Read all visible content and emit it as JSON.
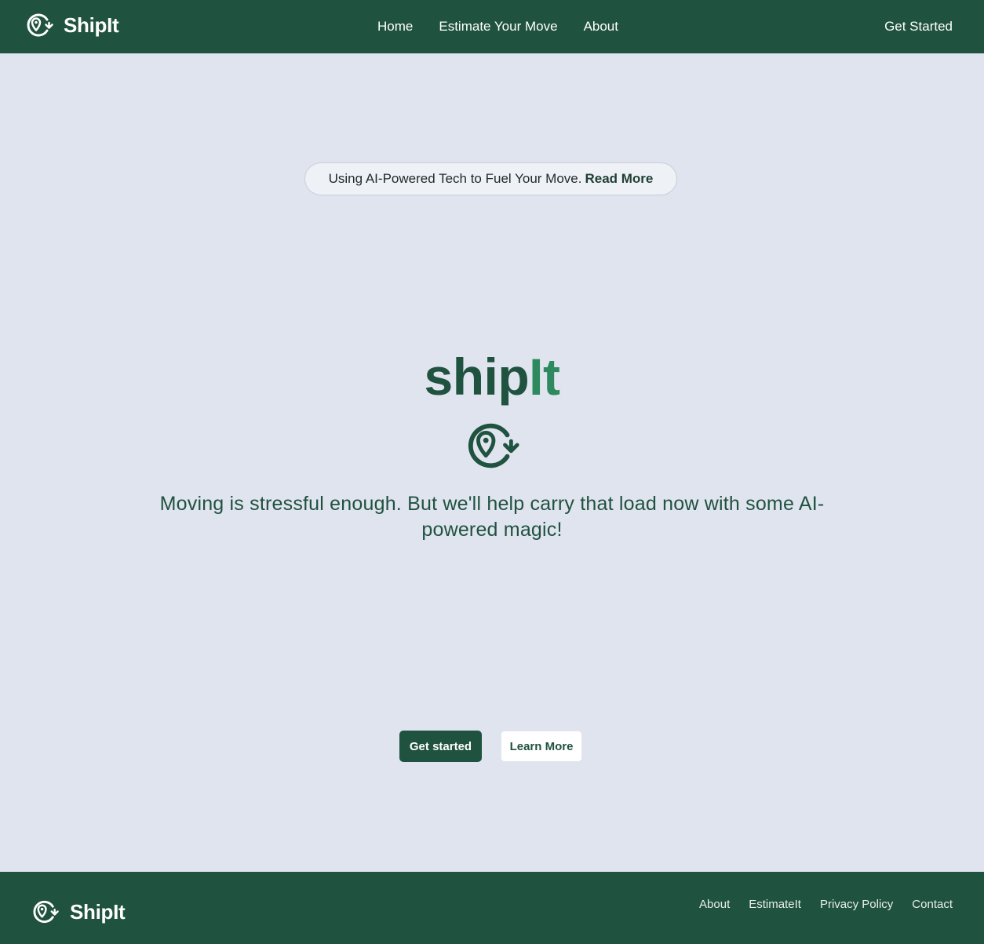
{
  "header": {
    "brand": "ShipIt",
    "nav": [
      "Home",
      "Estimate Your Move",
      "About"
    ],
    "cta": "Get Started"
  },
  "banner": {
    "text": "Using AI-Powered Tech to Fuel Your Move.",
    "link": "Read More"
  },
  "hero": {
    "title_part1": "ship",
    "title_part2": "It",
    "tagline": "Moving is stressful enough. But we'll help carry that load now with some AI-powered magic!",
    "primary_button": "Get started",
    "secondary_button": "Learn More"
  },
  "footer": {
    "brand": "ShipIt",
    "links": [
      "About",
      "EstimateIt",
      "Privacy Policy",
      "Contact"
    ]
  },
  "colors": {
    "brand_green": "#205240",
    "accent_green": "#2e8a5e",
    "background": "#e0e4ee"
  },
  "icons": {
    "logo": "location-pin-rotate-icon"
  }
}
